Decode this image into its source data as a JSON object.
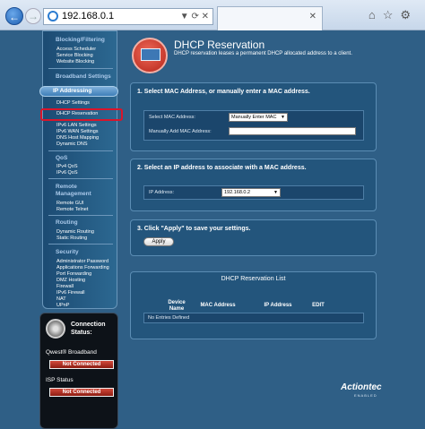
{
  "browser": {
    "url": "192.168.0.1",
    "tab_close": "✕",
    "address_controls": "▼ ⟳ ✕"
  },
  "sidebar": {
    "sections": [
      {
        "title": "Blocking/Filtering",
        "items": [
          "Access Scheduler",
          "Service Blocking",
          "Website Blocking"
        ]
      },
      {
        "title": "Broadband Settings",
        "items": []
      },
      {
        "title": "IP Addressing",
        "items": [
          "DHCP Settings",
          "DHCP Reservation",
          "IPv6 LAN Settings",
          "IPv6 WAN Settings",
          "DNS Host Mapping",
          "Dynamic DNS"
        ]
      },
      {
        "title": "QoS",
        "items": [
          "IPv4 QoS",
          "IPv6 QoS"
        ]
      },
      {
        "title": "Remote Management",
        "items": [
          "Remote GUI",
          "Remote Telnet"
        ]
      },
      {
        "title": "Routing",
        "items": [
          "Dynamic Routing",
          "Static Routing"
        ]
      },
      {
        "title": "Security",
        "items": [
          "Administrator Password",
          "Applications Forwarding",
          "Port Forwarding",
          "DMZ Hosting",
          "Firewall",
          "IPv6 Firewall",
          "NAT",
          "UPnP"
        ]
      }
    ]
  },
  "connection": {
    "title_line1": "Connection",
    "title_line2": "Status:",
    "broadband_label": "Qwest® Broadband",
    "broadband_status": "Not Connected",
    "isp_label": "ISP Status",
    "isp_status": "Not Connected"
  },
  "main": {
    "title": "DHCP Reservation",
    "subtitle": "DHCP reservation leases a permanent DHCP allocated address to a client.",
    "step1": {
      "title": "1. Select MAC Address, or manually enter a MAC address.",
      "select_label": "Select MAC Address:",
      "select_value": "Manually Enter MAC",
      "manual_label": "Manually Add MAC Address:",
      "manual_value": ""
    },
    "step2": {
      "title": "2. Select an IP address to associate with a MAC address.",
      "ip_label": "IP Address:",
      "ip_value": "192.168.0.2"
    },
    "step3": {
      "title": "3. Click \"Apply\" to save your settings.",
      "apply_label": "Apply"
    },
    "list": {
      "title": "DHCP Reservation List",
      "col_device": "Device Name",
      "col_mac": "MAC Address",
      "col_ip": "IP Address",
      "col_edit": "EDIT",
      "empty": "No Entries Defined"
    }
  },
  "brand": {
    "name": "Actiontec",
    "tagline": "ENABLED"
  },
  "colors": {
    "page_bg": "#2f5f86",
    "panel_bg": "#23557c",
    "highlight_red": "#d9152b",
    "status_red": "#b52a1e"
  }
}
